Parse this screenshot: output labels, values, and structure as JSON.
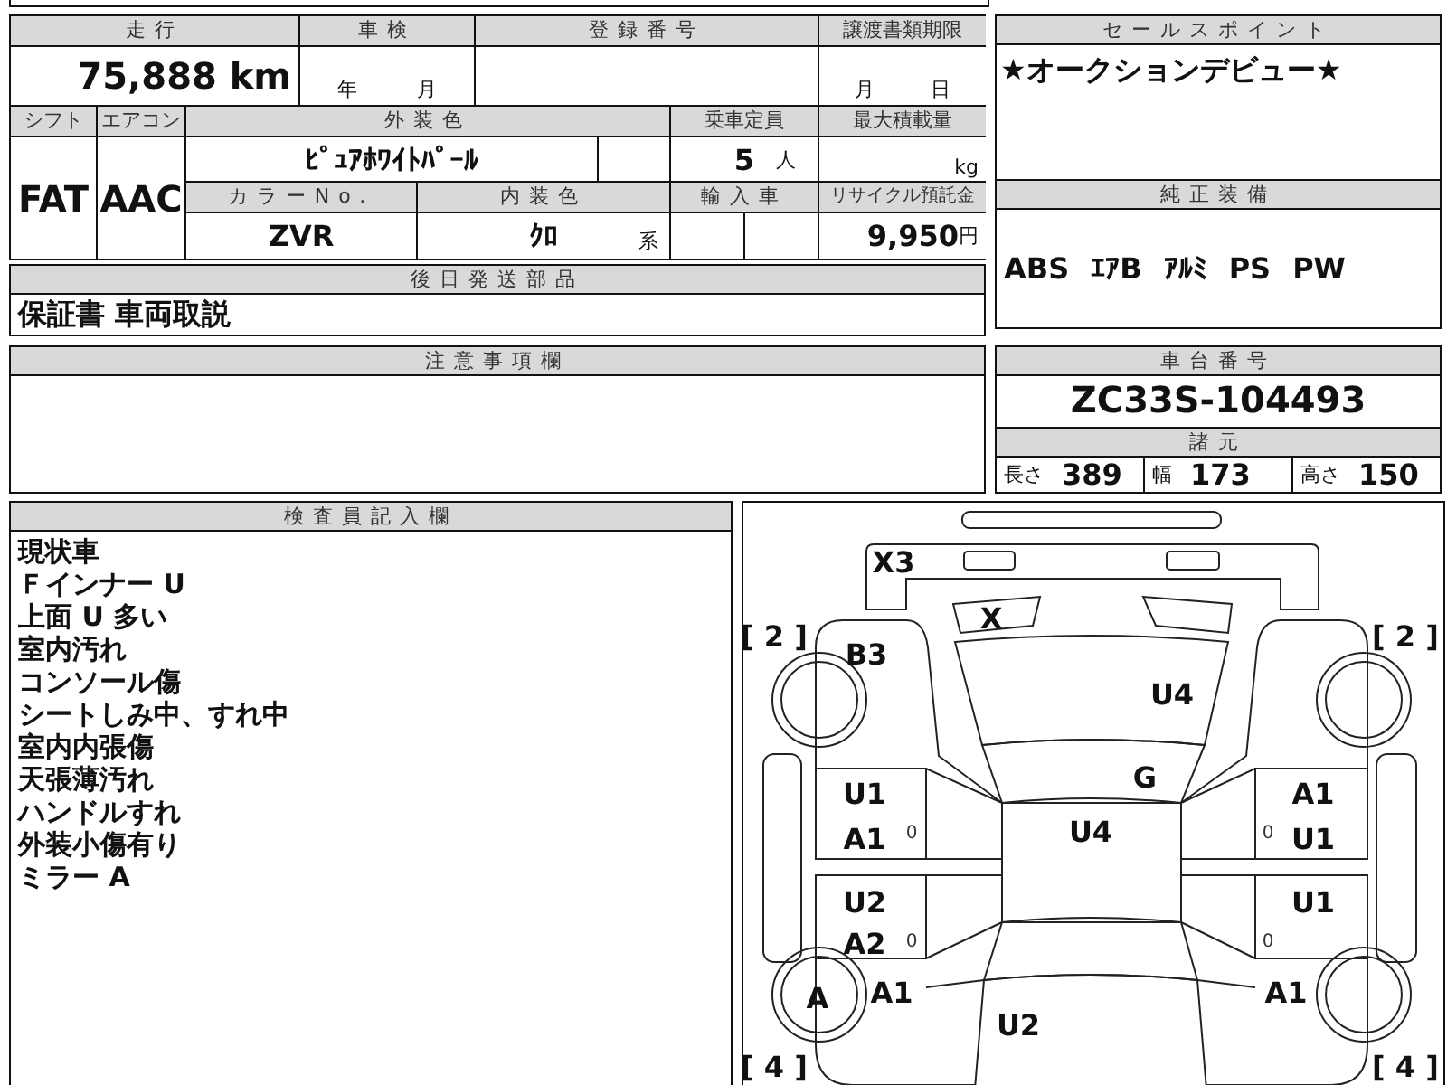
{
  "top_table": {
    "mileage": {
      "label": "走行",
      "value": "75,888",
      "unit": "km"
    },
    "inspection": {
      "label": "車検",
      "year_unit": "年",
      "month_unit": "月"
    },
    "registration_number": {
      "label": "登録番号"
    },
    "transfer_document_deadline": {
      "label": "譲渡書類期限",
      "month_unit": "月",
      "day_unit": "日"
    },
    "shift": {
      "label": "シフト",
      "value": "FAT"
    },
    "air_conditioner": {
      "label": "エアコン",
      "value": "AAC"
    },
    "exterior_color": {
      "label": "外装色",
      "value": "ﾋﾟｭｱﾎﾜｲﾄﾊﾟｰﾙ"
    },
    "capacity": {
      "label": "乗車定員",
      "value": "5",
      "unit": "人"
    },
    "max_load": {
      "label": "最大積載量",
      "unit": "kg"
    },
    "color_number": {
      "label": "カラーNo.",
      "value": "ZVR"
    },
    "interior_color": {
      "label": "内装色",
      "value": "ｸﾛ",
      "suffix": "系"
    },
    "imported": {
      "label": "輸入車"
    },
    "recycling_deposit": {
      "label": "リサイクル預託金",
      "value": "9,950",
      "unit": "円"
    }
  },
  "later_shipped_parts": {
    "label": "後日発送部品",
    "value": "保証書 車両取説"
  },
  "notes": {
    "label": "注意事項欄"
  },
  "sales_point": {
    "label": "セールスポイント",
    "value": "★オークションデビュー★"
  },
  "factory_equipment": {
    "label": "純正装備",
    "items": [
      "ABS",
      "ｴｱB",
      "ｱﾙﾐ",
      "PS",
      "PW"
    ]
  },
  "chassis_number": {
    "label": "車台番号",
    "value": "ZC33S-104493"
  },
  "specifications": {
    "label": "諸元",
    "items": [
      {
        "label": "長さ",
        "value": "389"
      },
      {
        "label": "幅",
        "value": "173"
      },
      {
        "label": "高さ",
        "value": "150"
      }
    ]
  },
  "inspector_notes": {
    "label": "検査員記入欄",
    "lines": [
      "現状車",
      "Ｆインナー U",
      "上面 U 多い",
      "室内汚れ",
      "コンソール傷",
      "シートしみ中、すれ中",
      "室内内張傷",
      "天張薄汚れ",
      "ハンドルすれ",
      "外装小傷有り",
      "ミラー A"
    ]
  },
  "damage_diagram": {
    "marks": {
      "front_panel": "X3",
      "front_grille": "X",
      "front_left_tyre": "[ 2 ]",
      "front_right_tyre": "[ 2 ]",
      "left_front_fender": "B3",
      "hood": "U4",
      "windshield": "G",
      "left_front_door_upper": "U1",
      "left_front_door_lower": "A1",
      "left_front_door_handle": "0",
      "roof": "U4",
      "right_front_door_upper": "A1",
      "right_front_door_handle": "0",
      "right_front_door_lower": "U1",
      "left_rear_door_upper": "U2",
      "left_rear_door_lower": "A2",
      "left_rear_door_handle": "0",
      "right_rear_door_upper": "U1",
      "right_rear_door_handle": "0",
      "left_rear_wheel": "A",
      "left_rear_fender": "A1",
      "rear_glass": "U2",
      "right_rear_fender": "A1",
      "rear_left_tyre": "[ 4 ]",
      "rear_right_tyre": "[ 4 ]"
    }
  }
}
